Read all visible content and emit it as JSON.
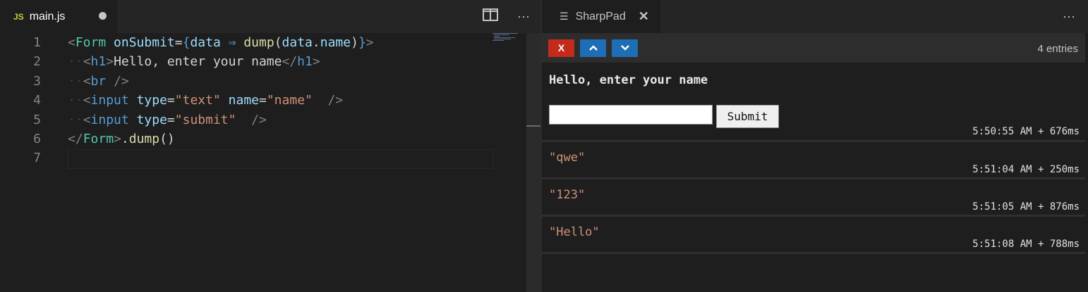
{
  "editor": {
    "tab": {
      "icon_label": "JS",
      "file_name": "main.js"
    },
    "line_numbers": [
      "1",
      "2",
      "3",
      "4",
      "5",
      "6",
      "7"
    ],
    "lines": [
      [
        [
          "tg",
          "<"
        ],
        [
          "cmp",
          "Form"
        ],
        [
          "tx",
          " "
        ],
        [
          "at",
          "onSubmit"
        ],
        [
          "tx",
          "="
        ],
        [
          "tn",
          "{"
        ],
        [
          "at",
          "data"
        ],
        [
          "tx",
          " "
        ],
        [
          "tn",
          "⇒"
        ],
        [
          "tx",
          " "
        ],
        [
          "fn",
          "dump"
        ],
        [
          "tx",
          "("
        ],
        [
          "at",
          "data"
        ],
        [
          "tx",
          "."
        ],
        [
          "at",
          "name"
        ],
        [
          "tx",
          ")"
        ],
        [
          "tn",
          "}"
        ],
        [
          "tg",
          ">"
        ]
      ],
      [
        [
          "ws",
          "··"
        ],
        [
          "tg",
          "<"
        ],
        [
          "tn",
          "h1"
        ],
        [
          "tg",
          ">"
        ],
        [
          "tx",
          "Hello, enter your name"
        ],
        [
          "tg",
          "</"
        ],
        [
          "tn",
          "h1"
        ],
        [
          "tg",
          ">"
        ]
      ],
      [
        [
          "ws",
          "··"
        ],
        [
          "tg",
          "<"
        ],
        [
          "tn",
          "br"
        ],
        [
          "tx",
          " "
        ],
        [
          "tg",
          "/>"
        ]
      ],
      [
        [
          "ws",
          "··"
        ],
        [
          "tg",
          "<"
        ],
        [
          "tn",
          "input"
        ],
        [
          "tx",
          " "
        ],
        [
          "at",
          "type"
        ],
        [
          "tx",
          "="
        ],
        [
          "st",
          "\"text\""
        ],
        [
          "tx",
          " "
        ],
        [
          "at",
          "name"
        ],
        [
          "tx",
          "="
        ],
        [
          "st",
          "\"name\""
        ],
        [
          "tx",
          "  "
        ],
        [
          "tg",
          "/>"
        ]
      ],
      [
        [
          "ws",
          "··"
        ],
        [
          "tg",
          "<"
        ],
        [
          "tn",
          "input"
        ],
        [
          "tx",
          " "
        ],
        [
          "at",
          "type"
        ],
        [
          "tx",
          "="
        ],
        [
          "st",
          "\"submit\""
        ],
        [
          "tx",
          "  "
        ],
        [
          "tg",
          "/>"
        ]
      ],
      [
        [
          "tg",
          "</"
        ],
        [
          "cmp",
          "Form"
        ],
        [
          "tg",
          ">"
        ],
        [
          "tx",
          "."
        ],
        [
          "fn",
          "dump"
        ],
        [
          "tx",
          "()"
        ]
      ],
      []
    ]
  },
  "sharppad": {
    "tab": {
      "icon": "lines-icon",
      "title": "SharpPad"
    },
    "buttons": {
      "clear": "X",
      "up": "▲",
      "down": "▼"
    },
    "colors": {
      "clear": "#c42b1c",
      "nav": "#1e6eb5"
    },
    "entries_count": "4 entries",
    "form": {
      "heading": "Hello, enter your name",
      "input_value": "",
      "submit_label": "Submit"
    },
    "entries": [
      {
        "timestamp": "5:50:55 AM + 676ms"
      },
      {
        "value": "\"qwe\"",
        "timestamp": "5:51:04 AM + 250ms"
      },
      {
        "value": "\"123\"",
        "timestamp": "5:51:05 AM + 876ms"
      },
      {
        "value": "\"Hello\"",
        "timestamp": "5:51:08 AM + 788ms"
      }
    ]
  }
}
